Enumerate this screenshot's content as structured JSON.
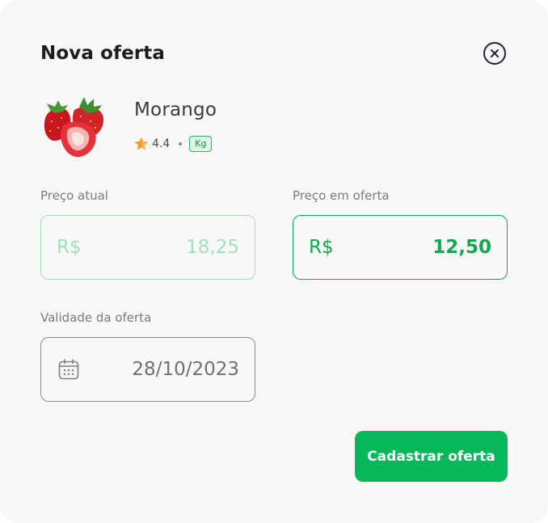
{
  "modal": {
    "title": "Nova oferta",
    "close_icon": "close-circle-icon"
  },
  "product": {
    "name": "Morango",
    "rating": "4.4",
    "unit": "Kg",
    "image": "strawberry-image"
  },
  "fields": {
    "current_price": {
      "label": "Preço atual",
      "prefix": "R$",
      "value": "18,25"
    },
    "offer_price": {
      "label": "Preço em oferta",
      "prefix": "R$",
      "value": "12,50"
    },
    "validity": {
      "label": "Validade da oferta",
      "value": "28/10/2023",
      "icon": "calendar-icon"
    }
  },
  "actions": {
    "submit_label": "Cadastrar oferta"
  },
  "colors": {
    "accent": "#06b85a",
    "accent_dark": "#12a84e",
    "star": "#f79a1e",
    "background": "#f8f8f8"
  }
}
